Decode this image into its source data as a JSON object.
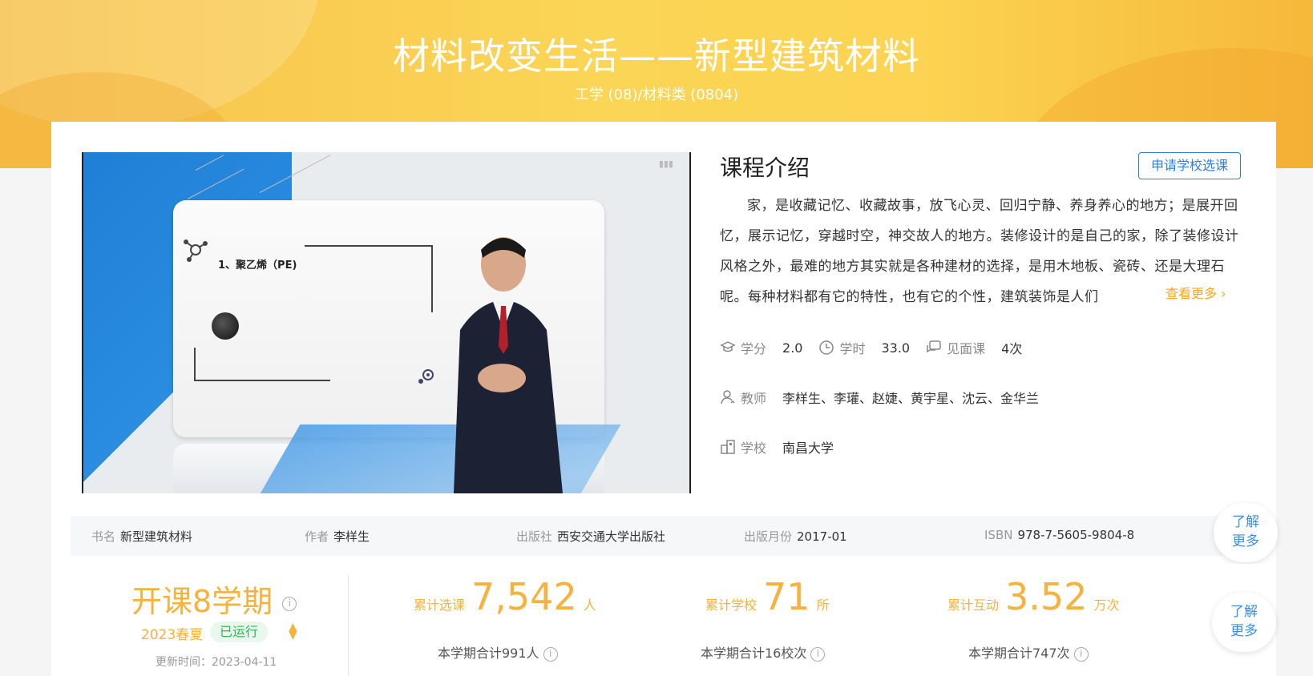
{
  "hero": {
    "title": "材料改变生活——新型建筑材料",
    "category": "工学 (08)/材料类 (0804)"
  },
  "video": {
    "slide_title": "1、聚乙烯（PE)"
  },
  "intro": {
    "heading": "课程介绍",
    "apply_label": "申请学校选课",
    "text": "家，是收藏记忆、收藏故事，放飞心灵、回归宁静、养身养心的地方；是展开回忆，展示记忆，穿越时空，神交故人的地方。装修设计的是自己的家，除了装修设计风格之外，最难的地方其实就是各种建材的选择，是用木地板、瓷砖、还是大理石呢。每种材料都有它的特性，也有它的个性，建筑装饰是人们",
    "more_label": "查看更多 ›"
  },
  "meta": {
    "credit_label": "学分",
    "credit_value": "2.0",
    "hours_label": "学时",
    "hours_value": "33.0",
    "meet_label": "见面课",
    "meet_value": "4次",
    "teacher_label": "教师",
    "teacher_value": "李样生、李瓘、赵婕、黄宇星、沈云、金华兰",
    "school_label": "学校",
    "school_value": "南昌大学"
  },
  "book": {
    "name_label": "书名",
    "name_value": "新型建筑材料",
    "author_label": "作者",
    "author_value": "李样生",
    "publisher_label": "出版社",
    "publisher_value": "西安交通大学出版社",
    "date_label": "出版月份",
    "date_value": "2017-01",
    "isbn_label": "ISBN",
    "isbn_value": "978-7-5605-9804-8"
  },
  "learn_more": {
    "line1": "了解",
    "line2": "更多"
  },
  "stats": {
    "terms": "开课8学期",
    "season": "2023春夏",
    "status": "已运行",
    "updated_label": "更新时间：",
    "updated_value": "2023-04-11",
    "selected_label": "累计选课",
    "selected_value": "7,542",
    "selected_unit": "人",
    "selected_sub": "本学期合计991人",
    "schools_label": "累计学校",
    "schools_value": "71",
    "schools_unit": "所",
    "schools_sub": "本学期合计16校次",
    "interact_label": "累计互动",
    "interact_value": "3.52",
    "interact_unit": "万次",
    "interact_sub": "本学期合计747次"
  },
  "colors": {
    "accent": "#f6b23b",
    "link": "#2f7fe0",
    "running": "#31b454"
  }
}
